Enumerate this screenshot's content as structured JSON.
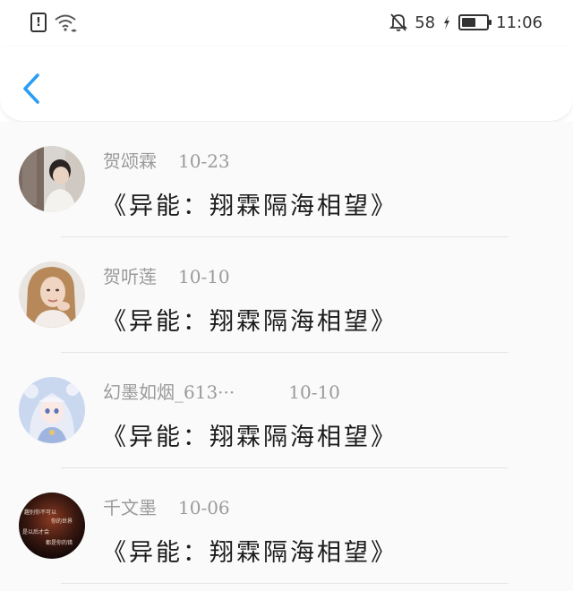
{
  "status_bar": {
    "battery_percent": "58",
    "time": "11:06",
    "battery_level": 0.58
  },
  "nav": {
    "back_icon": "chevron-left-icon",
    "accent_color": "#2b9df3"
  },
  "comments": [
    {
      "user": "贺颂霖",
      "date": "10-23",
      "title": "《异能：翔霖隔海相望》"
    },
    {
      "user": "贺听莲",
      "date": "10-10",
      "title": "《异能：翔霖隔海相望》"
    },
    {
      "user": "幻墨如烟_613···",
      "date": "10-10",
      "title": "《异能：翔霖隔海相望》"
    },
    {
      "user": "千文墨",
      "date": "10-06",
      "title": "《异能：翔霖隔海相望》"
    }
  ],
  "avatar_4_text": [
    "趣别你不可以",
    "你的世界",
    "是以后才会",
    "都是你的错"
  ]
}
